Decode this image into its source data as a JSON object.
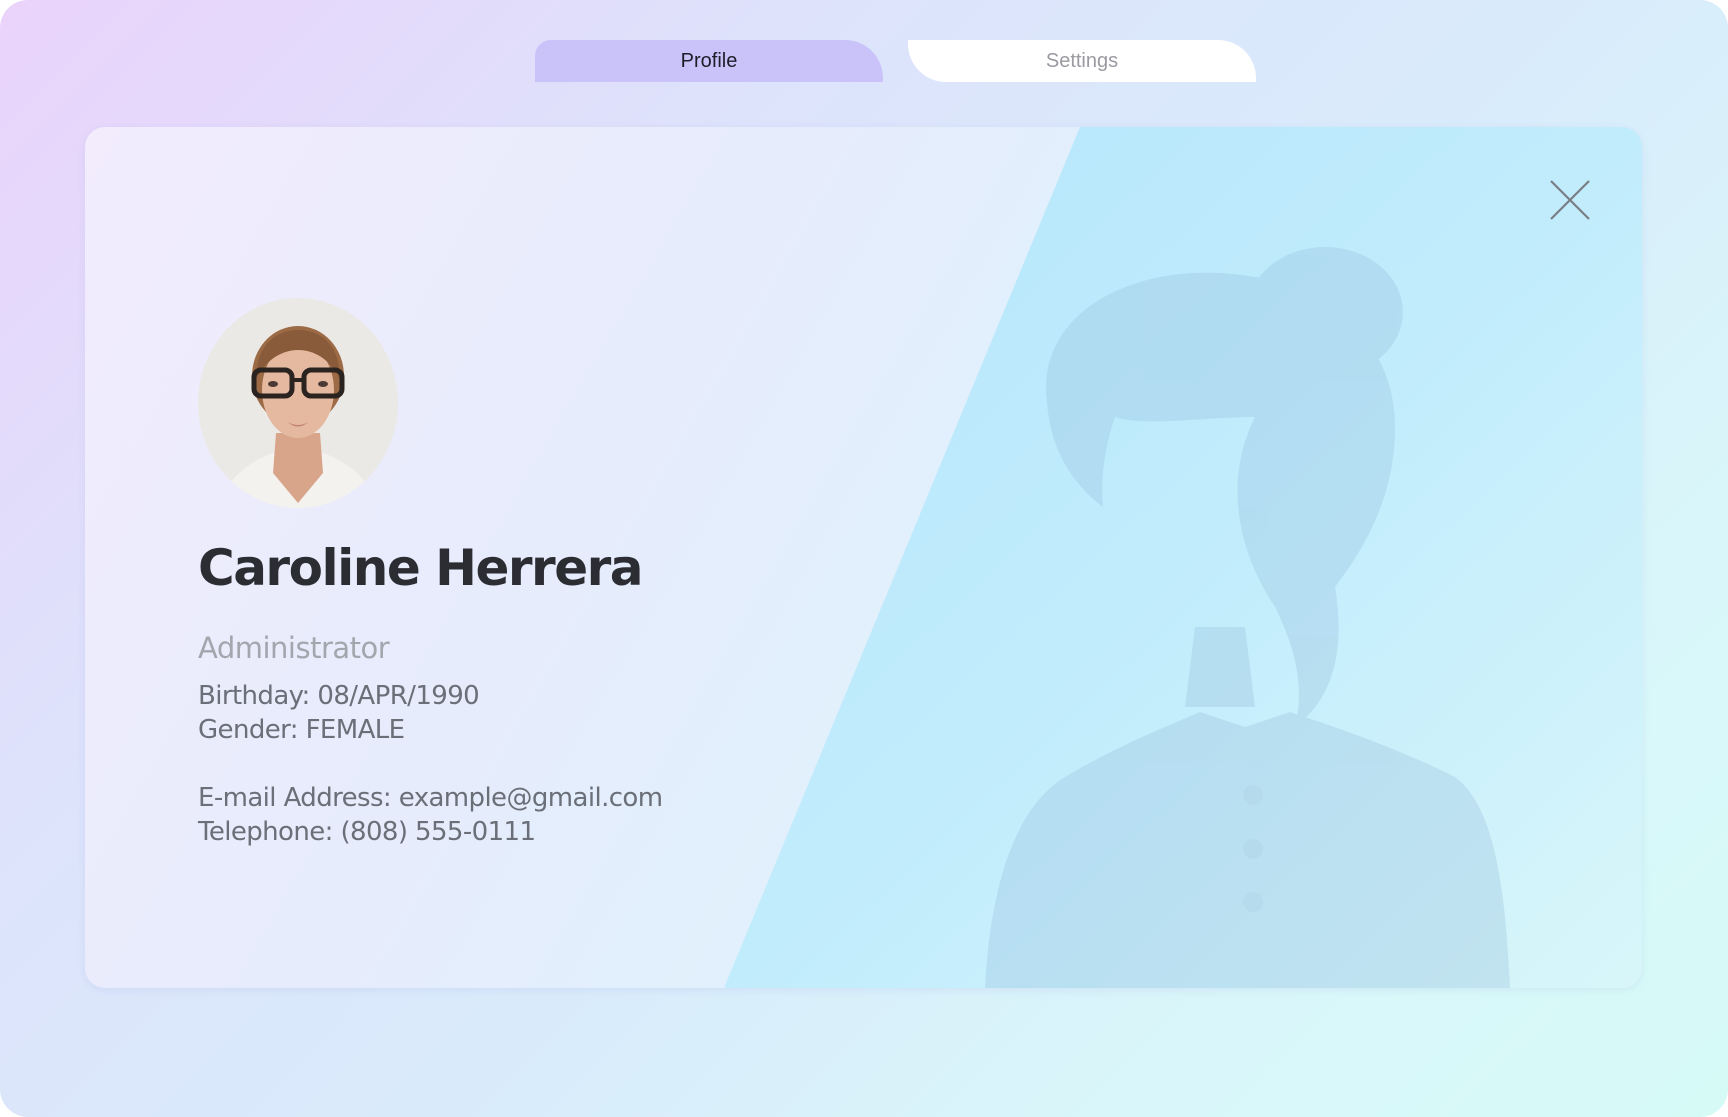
{
  "tabs": {
    "profile_label": "Profile",
    "settings_label": "Settings"
  },
  "profile": {
    "name": "Caroline Herrera",
    "role": "Administrator",
    "birthday": "Birthday: 08/APR/1990",
    "gender": "Gender: FEMALE",
    "email": "E-mail Address: example@gmail.com",
    "telephone": "Telephone: (808) 555-0111"
  },
  "icons": {
    "close": "close-icon",
    "avatar": "avatar",
    "silhouette": "person-silhouette-icon"
  },
  "colors": {
    "active_tab": "#c9c3f9",
    "inactive_tab": "#ffffff",
    "name_text": "#2b2d33",
    "role_text": "#a3a6ad",
    "info_text": "#6b6f78",
    "accent_panel": "#b7e6fb"
  }
}
